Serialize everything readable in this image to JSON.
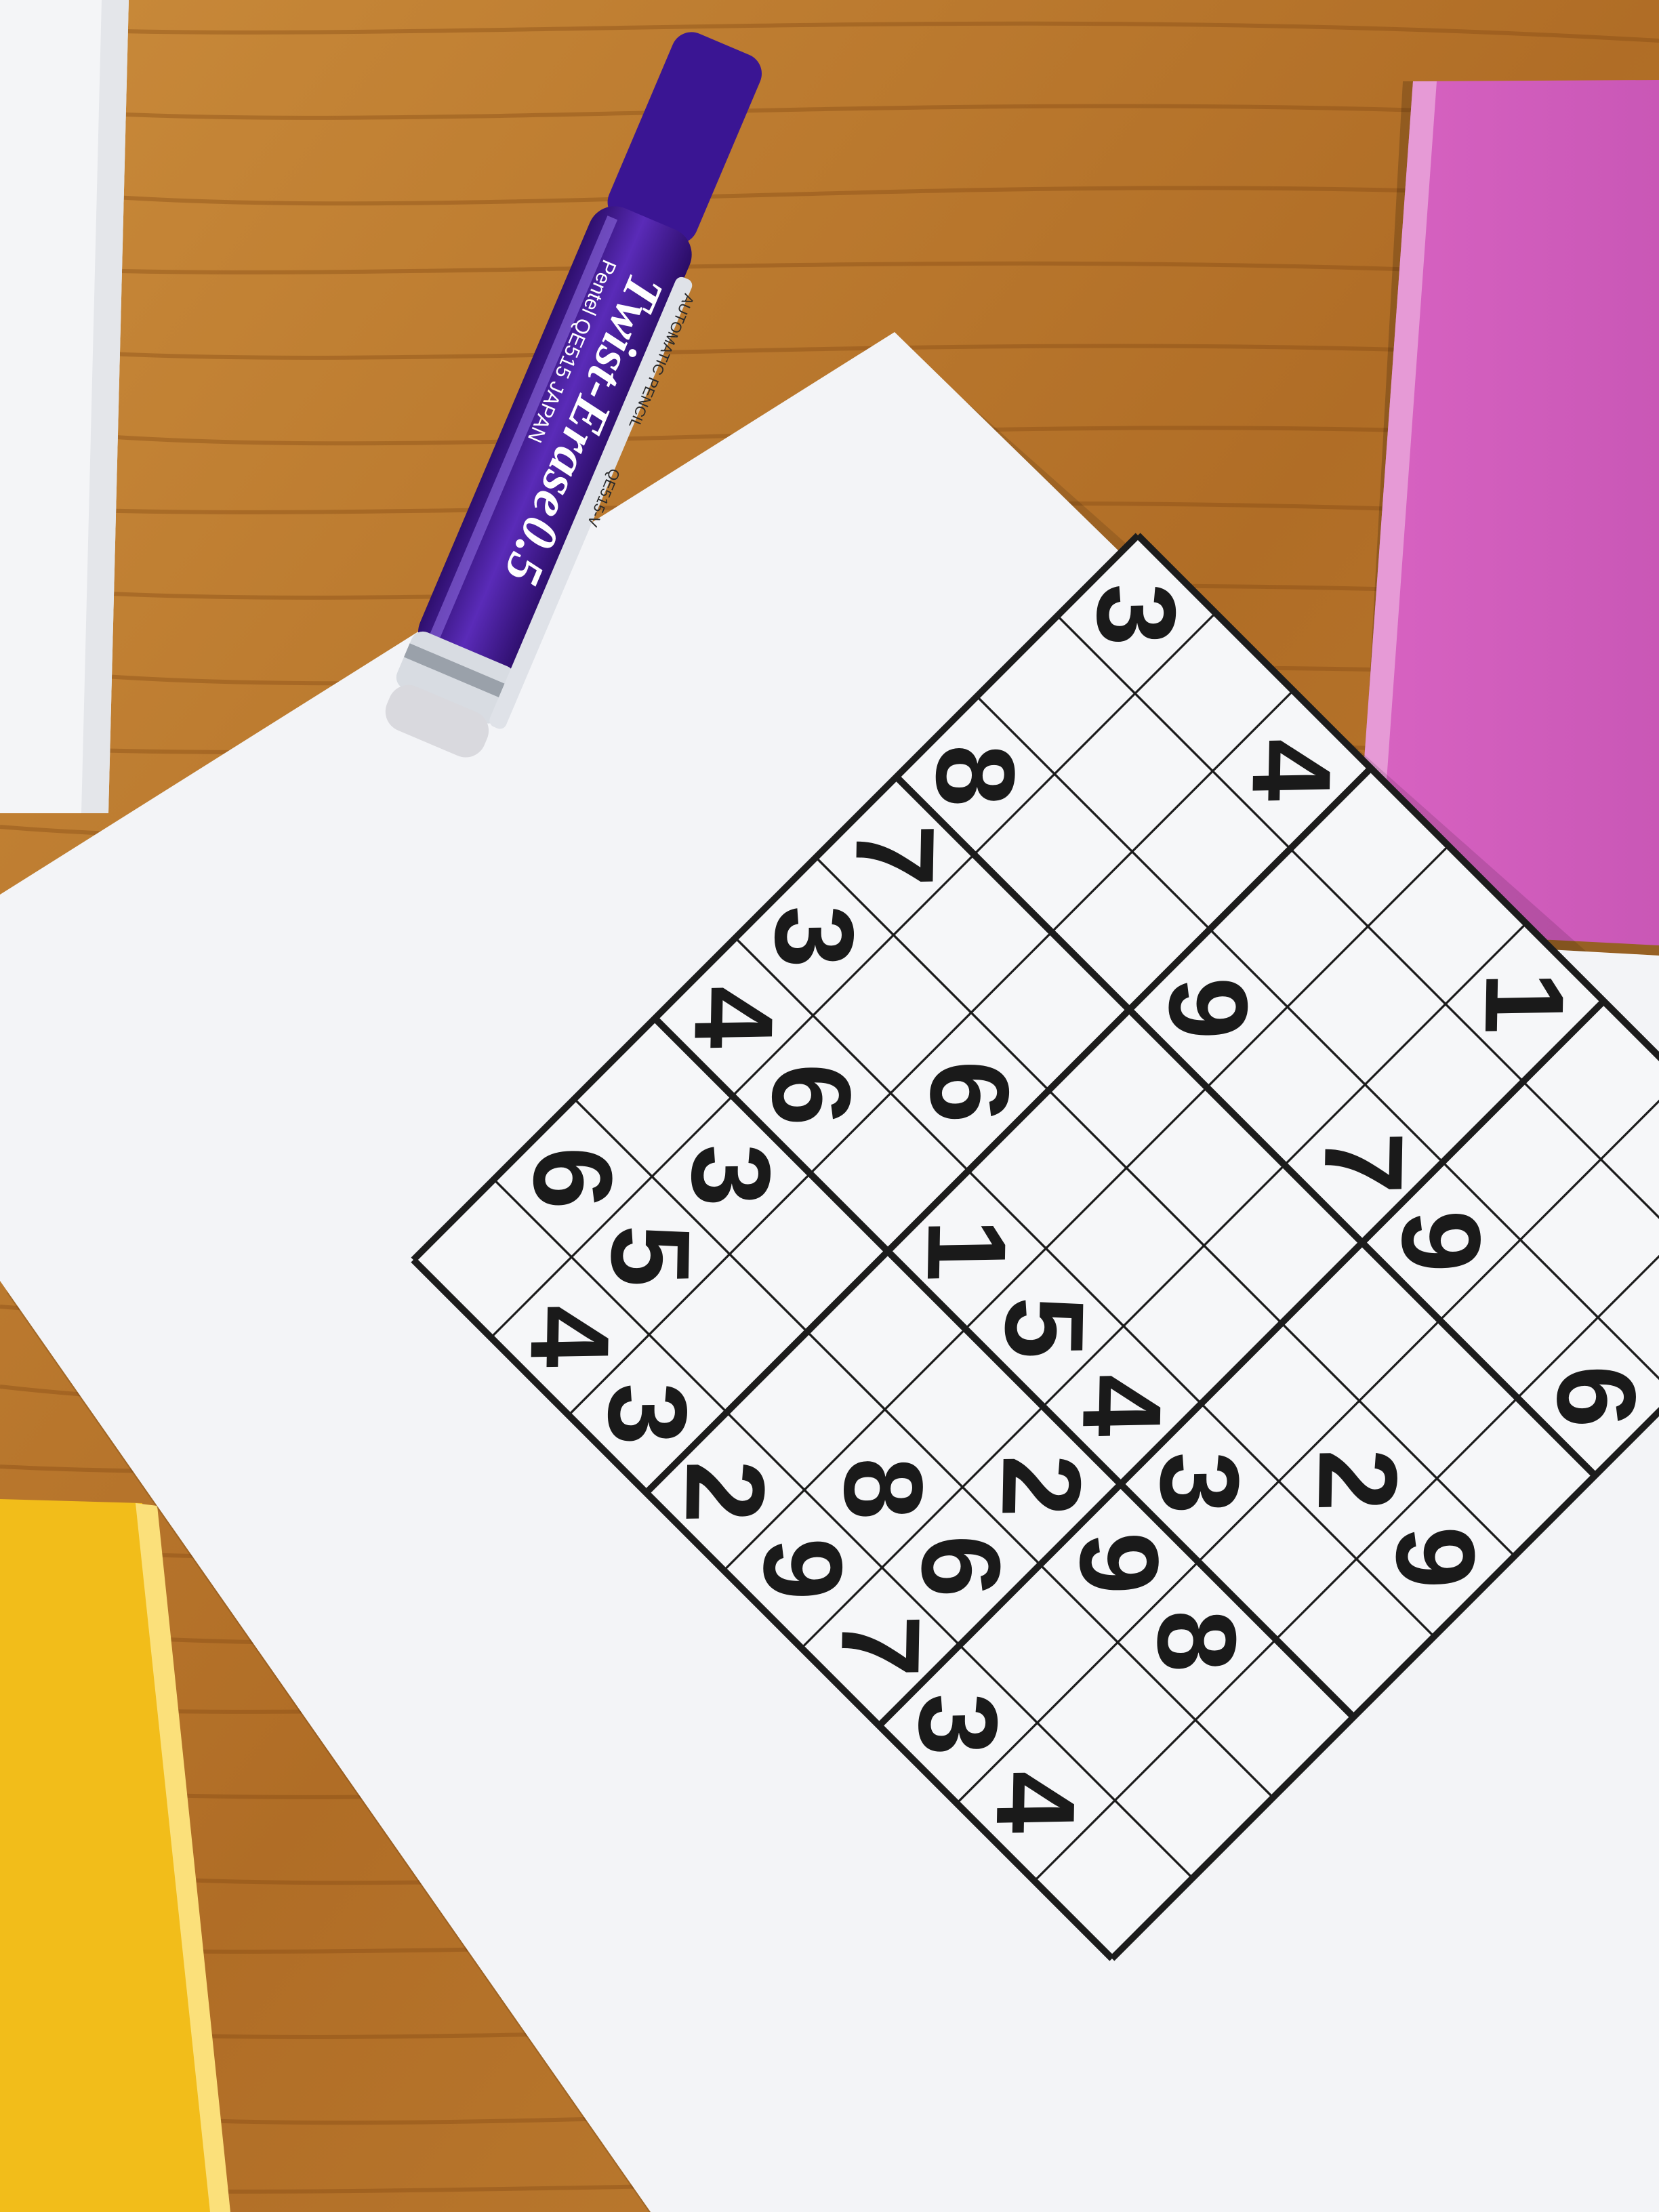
{
  "pen": {
    "brand_model": "Twist-Erase",
    "size": "0.5",
    "maker_line": "Pentel QE515 JAPAN",
    "mechanism_label": "AUTOMATIC PENCIL",
    "model_code": "QE515-V",
    "color": "#4a1e9c"
  },
  "sudoku": {
    "grid_rows": [
      [
        3,
        0,
        4,
        0,
        0,
        1,
        0,
        0,
        0
      ],
      [
        0,
        0,
        0,
        0,
        0,
        0,
        0,
        0,
        0
      ],
      [
        8,
        0,
        0,
        9,
        0,
        7,
        9,
        0,
        6
      ],
      [
        7,
        0,
        0,
        0,
        0,
        0,
        0,
        0,
        0
      ],
      [
        3,
        0,
        6,
        0,
        0,
        0,
        0,
        2,
        9
      ],
      [
        4,
        6,
        0,
        1,
        5,
        4,
        3,
        0,
        0
      ],
      [
        0,
        3,
        0,
        0,
        0,
        2,
        9,
        8,
        0
      ],
      [
        6,
        5,
        0,
        0,
        8,
        6,
        0,
        0,
        0
      ],
      [
        0,
        4,
        3,
        2,
        9,
        7,
        3,
        4,
        0
      ]
    ],
    "paper_color": "#f3f4f7",
    "line_color": "#1c1c1c"
  },
  "objects": {
    "sticky_pad_pink_color": "#cf5cb8",
    "sticky_pad_yellow_color": "#f2bd1a",
    "envelope_color": "#f4f5f7",
    "table_wood_color": "#b8762c"
  }
}
